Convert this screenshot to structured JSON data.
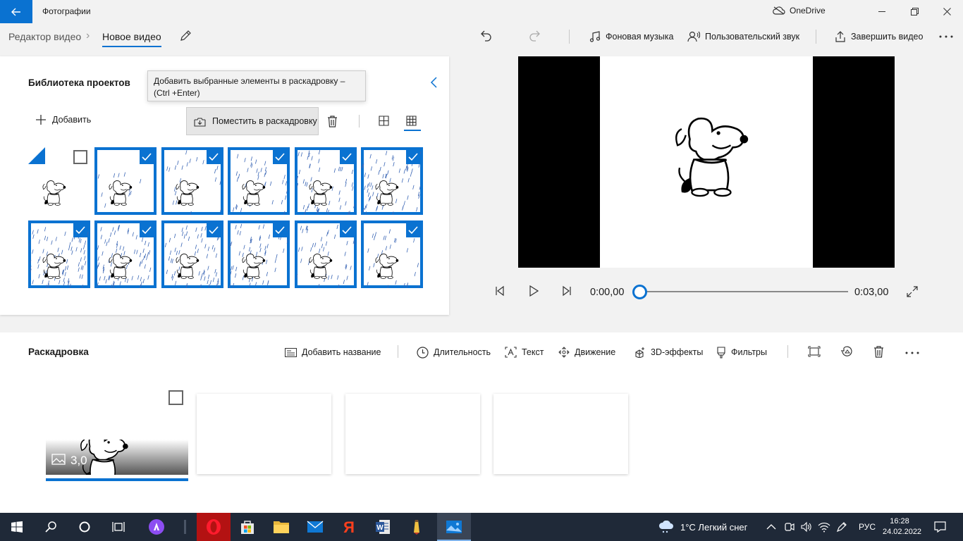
{
  "window": {
    "app_title": "Фотографии",
    "cloud_label": "OneDrive"
  },
  "header": {
    "breadcrumb_root": "Редактор видео",
    "breadcrumb_current": "Новое видео",
    "background_music": "Фоновая музыка",
    "custom_audio": "Пользовательский звук",
    "finish_video": "Завершить видео"
  },
  "library": {
    "title": "Библиотека проектов",
    "tooltip": "Добавить выбранные элементы в раскадровку – (Ctrl +Enter)",
    "add_label": "Добавить",
    "place_label": "Поместить в раскадровку",
    "items": [
      {
        "selected": false,
        "rain": 0
      },
      {
        "selected": true,
        "rain": 1
      },
      {
        "selected": true,
        "rain": 2
      },
      {
        "selected": true,
        "rain": 3
      },
      {
        "selected": true,
        "rain": 4
      },
      {
        "selected": true,
        "rain": 5
      },
      {
        "selected": true,
        "rain": 6
      },
      {
        "selected": true,
        "rain": 6
      },
      {
        "selected": true,
        "rain": 5
      },
      {
        "selected": true,
        "rain": 4
      },
      {
        "selected": true,
        "rain": 3
      },
      {
        "selected": true,
        "rain": 2
      }
    ]
  },
  "player": {
    "current_time": "0:00,00",
    "total_time": "0:03,00",
    "progress": 0
  },
  "storyboard": {
    "title": "Раскадровка",
    "add_title": "Добавить название",
    "duration": "Длительность",
    "text": "Текст",
    "motion": "Движение",
    "effects3d": "3D-эффекты",
    "filters": "Фильтры",
    "clip_duration": "3,0"
  },
  "taskbar": {
    "weather": "1°C  Легкий снег",
    "language": "РУС",
    "time": "16:28",
    "date": "24.02.2022"
  },
  "colors": {
    "accent": "#0a72d1",
    "taskbar": "#1f2938"
  }
}
